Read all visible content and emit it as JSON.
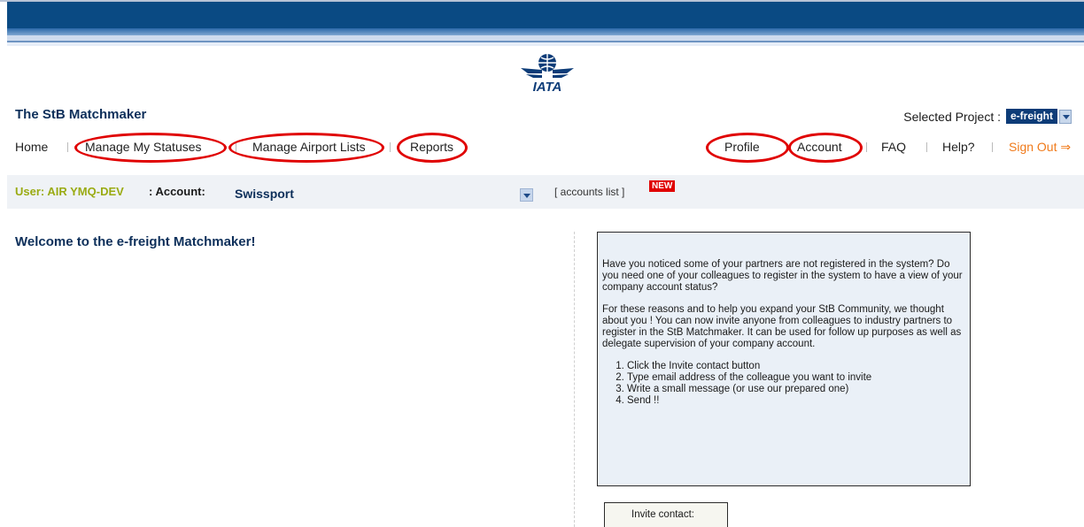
{
  "header": {
    "logo_text": "IATA",
    "app_title": "The StB Matchmaker",
    "project_label": "Selected Project :",
    "project_value": "e-freight"
  },
  "nav": {
    "left": [
      {
        "label": "Home"
      },
      {
        "label": "Manage My Statuses"
      },
      {
        "label": "Manage Airport Lists"
      },
      {
        "label": "Reports"
      }
    ],
    "right": [
      {
        "label": "Profile"
      },
      {
        "label": "Account"
      },
      {
        "label": "FAQ"
      },
      {
        "label": "Help?"
      },
      {
        "label": "Sign Out ⇒"
      }
    ]
  },
  "userbar": {
    "user": "User: AIR YMQ-DEV",
    "account_label": ": Account:",
    "account_value": "Swissport",
    "accounts_list": "[ accounts list ]",
    "new_badge": "NEW"
  },
  "main": {
    "welcome": "Welcome to the e-freight Matchmaker!",
    "info": {
      "para1": "Have you noticed some of your partners are not registered in the system? Do you need one of your colleagues to register in the system to have a view of your company account status?",
      "para2": "For these reasons and to help you expand your StB Community, we thought about you ! You can now invite anyone from colleagues to industry partners to register in the StB Matchmaker. It can be used for follow up purposes as well as delegate supervision of your company account.",
      "steps": [
        "Click the Invite contact button",
        "Type email address of the colleague you want to invite",
        "Write a small message (or use our prepared one)",
        "Send !!"
      ]
    },
    "invite_label": "Invite contact:"
  },
  "colors": {
    "banner": "#0a4a83",
    "title": "#0d2f5a",
    "user": "#9aab12",
    "highlight_ring": "#e00000",
    "signout": "#f07a1a"
  }
}
